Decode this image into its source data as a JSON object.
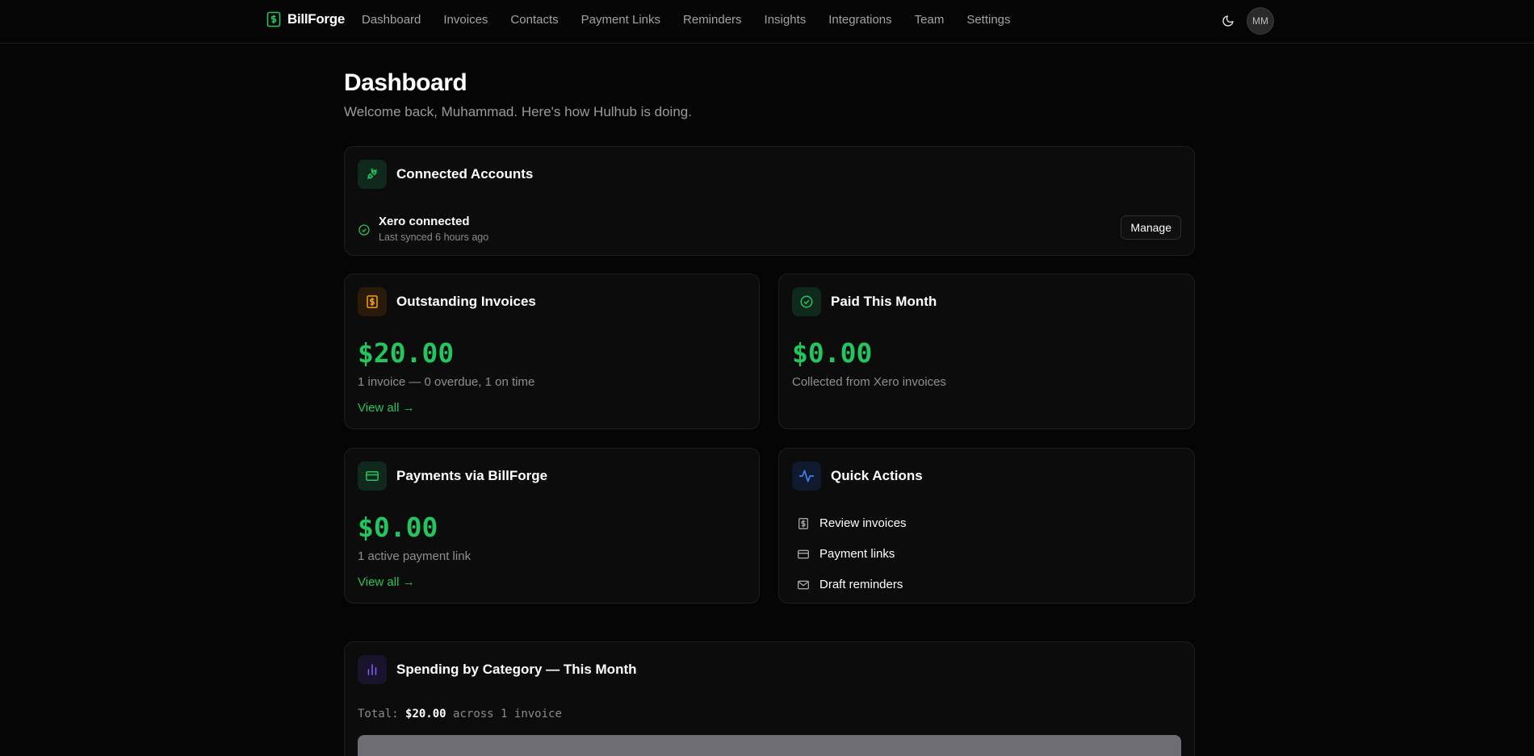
{
  "brand": {
    "name": "BillForge"
  },
  "nav": [
    {
      "label": "Dashboard"
    },
    {
      "label": "Invoices"
    },
    {
      "label": "Contacts"
    },
    {
      "label": "Payment Links"
    },
    {
      "label": "Reminders"
    },
    {
      "label": "Insights"
    },
    {
      "label": "Integrations"
    },
    {
      "label": "Team"
    },
    {
      "label": "Settings"
    }
  ],
  "user": {
    "initials": "MM"
  },
  "header": {
    "title": "Dashboard",
    "subtitle": "Welcome back, Muhammad. Here's how Hulhub is doing."
  },
  "connected": {
    "title": "Connected Accounts",
    "account": "Xero connected",
    "synced": "Last synced 6 hours ago",
    "manage_label": "Manage"
  },
  "outstanding": {
    "title": "Outstanding Invoices",
    "amount": "$20.00",
    "detail": "1 invoice — 0 overdue, 1 on time",
    "link": "View all →"
  },
  "paid": {
    "title": "Paid This Month",
    "amount": "$0.00",
    "detail": "Collected from Xero invoices"
  },
  "payments": {
    "title": "Payments via BillForge",
    "amount": "$0.00",
    "detail": "1 active payment link",
    "link": "View all →"
  },
  "quick_actions": {
    "title": "Quick Actions",
    "items": [
      {
        "label": "Review invoices",
        "icon": "invoice-icon"
      },
      {
        "label": "Payment links",
        "icon": "card-icon"
      },
      {
        "label": "Draft reminders",
        "icon": "mail-icon"
      }
    ]
  },
  "spending": {
    "title": "Spending by Category — This Month",
    "total_prefix": "Total:",
    "total_amount": "$20.00",
    "total_suffix": "across 1 invoice"
  },
  "colors": {
    "accent": "#22c55e",
    "background": "#050505",
    "card": "#0c0c0c",
    "orange": "#f59e0b",
    "blue": "#3b82f6",
    "purple": "#8b5cf6"
  }
}
